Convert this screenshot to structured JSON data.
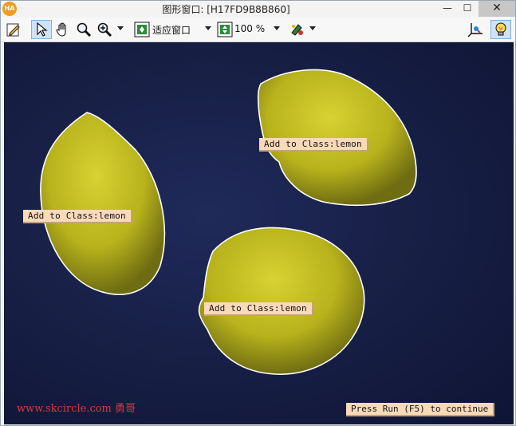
{
  "window": {
    "title": "图形窗口: [H17FD9B8B860]",
    "app_icon_text": "HA",
    "minimize_glyph": "—",
    "maximize_glyph": "☐",
    "close_glyph": "✕"
  },
  "toolbar": {
    "zoom_mode": "适应窗口",
    "zoom_percent": "100 %",
    "icons": [
      "edit-icon",
      "pointer-icon",
      "hand-pan-icon",
      "magnifier-icon",
      "zoom-in-icon",
      "fit-window-icon",
      "zoom-percent-icon",
      "paint-color-icon",
      "axes-icon",
      "lightbulb-icon"
    ]
  },
  "canvas": {
    "background": "#161e44",
    "contour_color": "#ffffff",
    "lemon_color": "#c9c21f",
    "labels": [
      {
        "text": "Add to Class:lemon"
      },
      {
        "text": "Add to Class:lemon"
      },
      {
        "text": "Add to Class:lemon"
      }
    ],
    "watermark": "www.skcircle.com 勇哥",
    "status_message": "Press Run (F5) to continue"
  }
}
